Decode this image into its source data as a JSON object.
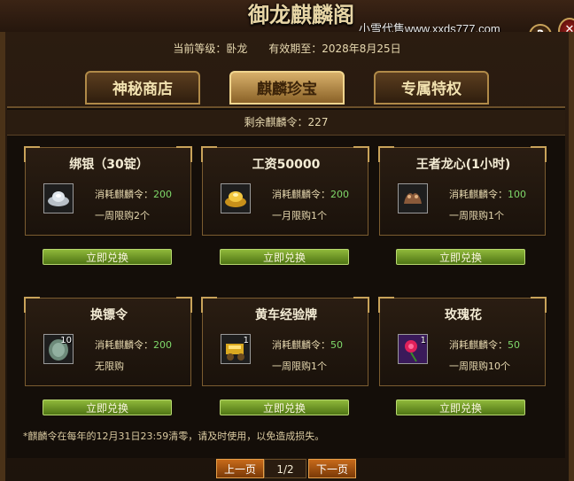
{
  "banner": {
    "title": "御龙麒麟阁"
  },
  "watermark": "小雪代售www.xxds777.com",
  "buttons": {
    "help": "?",
    "close": "✕"
  },
  "status": {
    "level_label": "当前等级：卧龙",
    "expiry_label": "有效期至：2028年8月25日"
  },
  "tabs": [
    {
      "label": "神秘商店"
    },
    {
      "label": "麒麟珍宝"
    },
    {
      "label": "专属特权"
    }
  ],
  "remaining": "剩余麒麟令：227",
  "cards": [
    {
      "title": "绑银（30锭）",
      "cost_label": "消耗麒麟令：",
      "cost": "200",
      "limit": "一周限购2个",
      "qty": "",
      "icon": "silver-ingot-icon",
      "button": "立即兑换"
    },
    {
      "title": "工资50000",
      "cost_label": "消耗麒麟令：",
      "cost": "200",
      "limit": "一月限购1个",
      "qty": "",
      "icon": "gold-ingot-icon",
      "button": "立即兑换"
    },
    {
      "title": "王者龙心(1小时)",
      "cost_label": "消耗麒麟令：",
      "cost": "100",
      "limit": "一周限购1个",
      "qty": "",
      "icon": "dragon-heart-icon",
      "button": "立即兑换"
    },
    {
      "title": "换镖令",
      "cost_label": "消耗麒麟令：",
      "cost": "200",
      "limit": "无限购",
      "qty": "10",
      "icon": "token-icon",
      "button": "立即兑换"
    },
    {
      "title": "黄车经验牌",
      "cost_label": "消耗麒麟令：",
      "cost": "50",
      "limit": "一周限购1个",
      "qty": "1",
      "icon": "gold-cart-icon",
      "button": "立即兑换"
    },
    {
      "title": "玫瑰花",
      "cost_label": "消耗麒麟令：",
      "cost": "50",
      "limit": "一周限购10个",
      "qty": "1",
      "icon": "rose-icon",
      "button": "立即兑换"
    }
  ],
  "footnote": "*麒麟令在每年的12月31日23:59清零，请及时使用，以免造成损失。",
  "pager": {
    "prev": "上一页",
    "page": "1/2",
    "next": "下一页"
  },
  "colors": {
    "accent_gold": "#c9a35a",
    "cost_green": "#7fd96a",
    "button_green": "#6f9a24"
  }
}
